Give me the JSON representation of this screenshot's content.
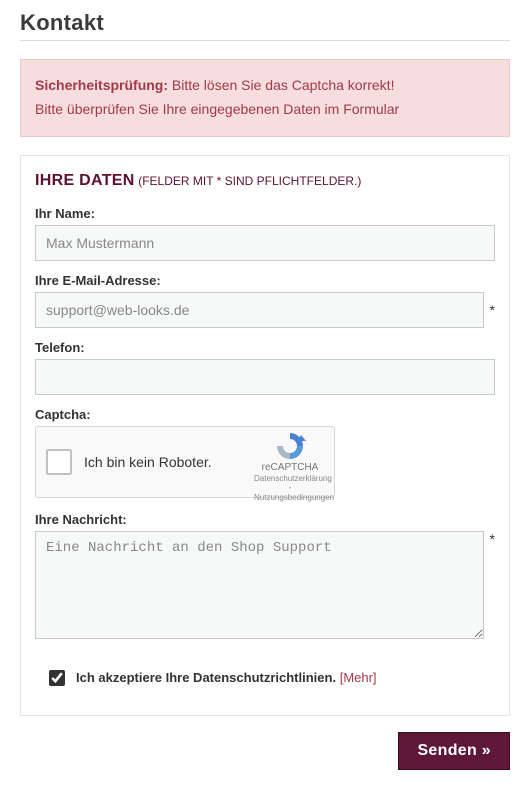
{
  "pageTitle": "Kontakt",
  "alert": {
    "strong": "Sicherheitsprüfung:",
    "line1": "Bitte lösen Sie das Captcha korrekt!",
    "line2": "Bitte überprüfen Sie Ihre eingegebenen Daten im Formular"
  },
  "sectionTitle": {
    "main": "IHRE DATEN",
    "note": "(FELDER MIT * SIND PFLICHTFELDER.)"
  },
  "fields": {
    "name_label": "Ihr Name:",
    "name_placeholder": "Max Mustermann",
    "email_label": "Ihre E-Mail-Adresse:",
    "email_placeholder": "support@web-looks.de",
    "phone_label": "Telefon:",
    "captcha_label": "Captcha:",
    "message_label": "Ihre Nachricht:",
    "message_placeholder": "Eine Nachricht an den Shop Support",
    "required_mark": "*"
  },
  "recaptcha": {
    "text": "Ich bin kein Roboter.",
    "brand": "reCAPTCHA",
    "links": "Datenschutzerklärung - Nutzungsbedingungen"
  },
  "privacy": {
    "checked": true,
    "text": "Ich akzeptiere Ihre Datenschutzrichtlinien.",
    "more": "[Mehr]"
  },
  "submit_label": "Senden »"
}
